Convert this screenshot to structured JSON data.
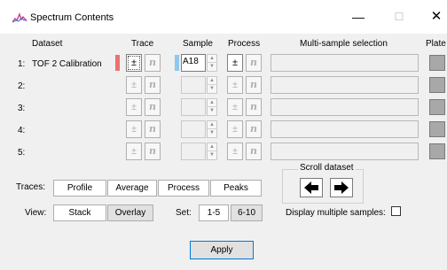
{
  "window": {
    "title": "Spectrum Contents",
    "controls": [
      "—",
      "☐",
      "✕"
    ]
  },
  "headers": {
    "dataset": "Dataset",
    "trace": "Trace",
    "sample": "Sample",
    "process": "Process",
    "multi": "Multi-sample selection",
    "plate": "Plate"
  },
  "rows": [
    {
      "num": "1:",
      "name": "TOF 2 Calibration",
      "sample": "A18",
      "active": true
    },
    {
      "num": "2:",
      "name": "",
      "sample": "",
      "active": false
    },
    {
      "num": "3:",
      "name": "",
      "sample": "",
      "active": false
    },
    {
      "num": "4:",
      "name": "",
      "sample": "",
      "active": false
    },
    {
      "num": "5:",
      "name": "",
      "sample": "",
      "active": false
    }
  ],
  "glyphs": {
    "plus_minus": "±",
    "n": "n",
    "up": "▲",
    "down": "▼"
  },
  "colors": {
    "trace_swatch": "#f07070",
    "sample_swatch": "#8ec8f0"
  },
  "traces": {
    "label": "Traces:",
    "buttons": [
      "Profile",
      "Average",
      "Process",
      "Peaks"
    ]
  },
  "view": {
    "label": "View:",
    "buttons": [
      "Stack",
      "Overlay"
    ]
  },
  "set": {
    "label": "Set:",
    "buttons": [
      "1-5",
      "6-10"
    ]
  },
  "scroll": {
    "label": "Scroll dataset",
    "left_icon": "arrow-left-icon",
    "right_icon": "arrow-right-icon"
  },
  "display_multiple": {
    "label": "Display multiple samples:",
    "checked": false
  },
  "apply_label": "Apply"
}
